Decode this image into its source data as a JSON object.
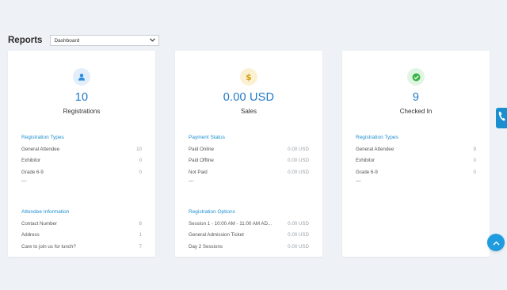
{
  "header": {
    "title": "Reports",
    "view_select": {
      "selected": "Dashboard"
    }
  },
  "colors": {
    "accent": "#1f77c4",
    "section_title": "#1f8fd0",
    "background": "#eef1f5"
  },
  "cards": [
    {
      "icon": "user-icon",
      "value": "10",
      "label": "Registrations",
      "sections": [
        {
          "title": "Registration Types",
          "rows": [
            {
              "name": "General Attendee",
              "value": "10"
            },
            {
              "name": "Exhibitor",
              "value": "0"
            },
            {
              "name": "Grade 6-9",
              "value": "0"
            }
          ],
          "more": "---"
        },
        {
          "title": "Attendee Information",
          "rows": [
            {
              "name": "Contact Number",
              "value": "8"
            },
            {
              "name": "Address",
              "value": "1"
            },
            {
              "name": "Care to join us for lunch?",
              "value": "7"
            }
          ]
        }
      ]
    },
    {
      "icon": "dollar-icon",
      "value": "0.00 USD",
      "label": "Sales",
      "sections": [
        {
          "title": "Payment Status",
          "rows": [
            {
              "name": "Paid Online",
              "value": "0.00 USD"
            },
            {
              "name": "Paid Offline",
              "value": "0.00 USD"
            },
            {
              "name": "Not Paid",
              "value": "0.00 USD"
            }
          ],
          "more": "---"
        },
        {
          "title": "Registration Options",
          "rows": [
            {
              "name": "Session 1 - 10:00 AM - 11:00 AM AD...",
              "value": "0.00 USD"
            },
            {
              "name": "General Admission Ticket",
              "value": "0.00 USD"
            },
            {
              "name": "Day 2 Sessions",
              "value": "0.00 USD"
            }
          ]
        }
      ]
    },
    {
      "icon": "check-icon",
      "value": "9",
      "label": "Checked In",
      "sections": [
        {
          "title": "Registration Types",
          "rows": [
            {
              "name": "General Attendee",
              "value": "9"
            },
            {
              "name": "Exhibitor",
              "value": "0"
            },
            {
              "name": "Grade 6-9",
              "value": "0"
            }
          ],
          "more": "---"
        }
      ]
    }
  ],
  "widgets": {
    "phone_tab_icon": "phone-icon",
    "scroll_top_icon": "chevron-up-icon"
  }
}
